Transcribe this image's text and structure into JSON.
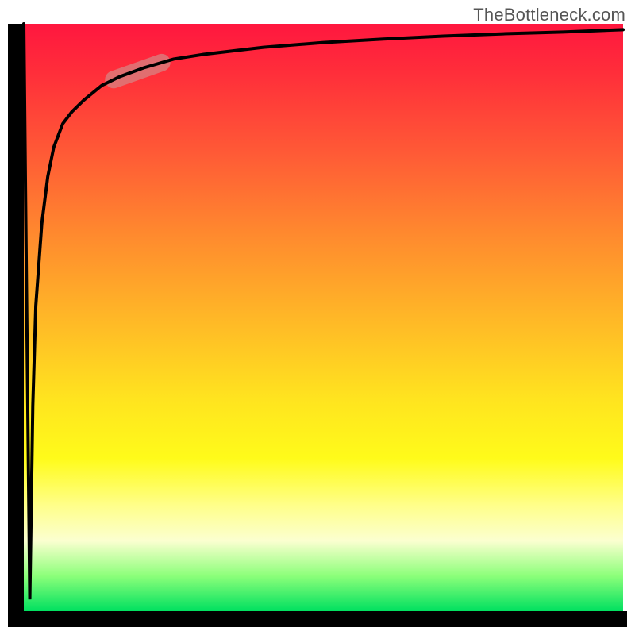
{
  "watermark": "TheBottleneck.com",
  "colors": {
    "gradient_top": "#ff173f",
    "gradient_bottom": "#00e060",
    "axis": "#000000",
    "curve": "#000000",
    "highlight": "#d98080"
  },
  "chart_data": {
    "type": "line",
    "title": "",
    "xlabel": "",
    "ylabel": "",
    "xlim": [
      0,
      100
    ],
    "ylim": [
      0,
      100
    ],
    "grid": false,
    "legend": false,
    "series": [
      {
        "name": "bottleneck-curve",
        "description": "Starts at 100 on the y-axis at x=0, plunges to ~0 near x≈1, then rises very steeply and asymptotically flattens toward ~99 across the domain (log-like shoulder).",
        "x": [
          0,
          0.5,
          1,
          1.2,
          1.5,
          2,
          3,
          4,
          5,
          6.5,
          8,
          10,
          13,
          16,
          20,
          25,
          30,
          40,
          50,
          60,
          70,
          80,
          90,
          100
        ],
        "values": [
          100,
          50,
          2,
          15,
          35,
          52,
          66,
          74,
          79,
          83,
          85,
          87,
          89.5,
          91,
          92.5,
          94,
          94.8,
          96,
          96.8,
          97.4,
          97.9,
          98.3,
          98.6,
          99
        ]
      }
    ],
    "highlight_region": {
      "series": "bottleneck-curve",
      "x_start": 15,
      "x_end": 23
    },
    "background_gradient": {
      "stops": [
        {
          "pct": 0,
          "color": "#ff173f"
        },
        {
          "pct": 50,
          "color": "#ffe41f"
        },
        {
          "pct": 88,
          "color": "#fbffd0"
        },
        {
          "pct": 100,
          "color": "#00e060"
        }
      ]
    }
  }
}
